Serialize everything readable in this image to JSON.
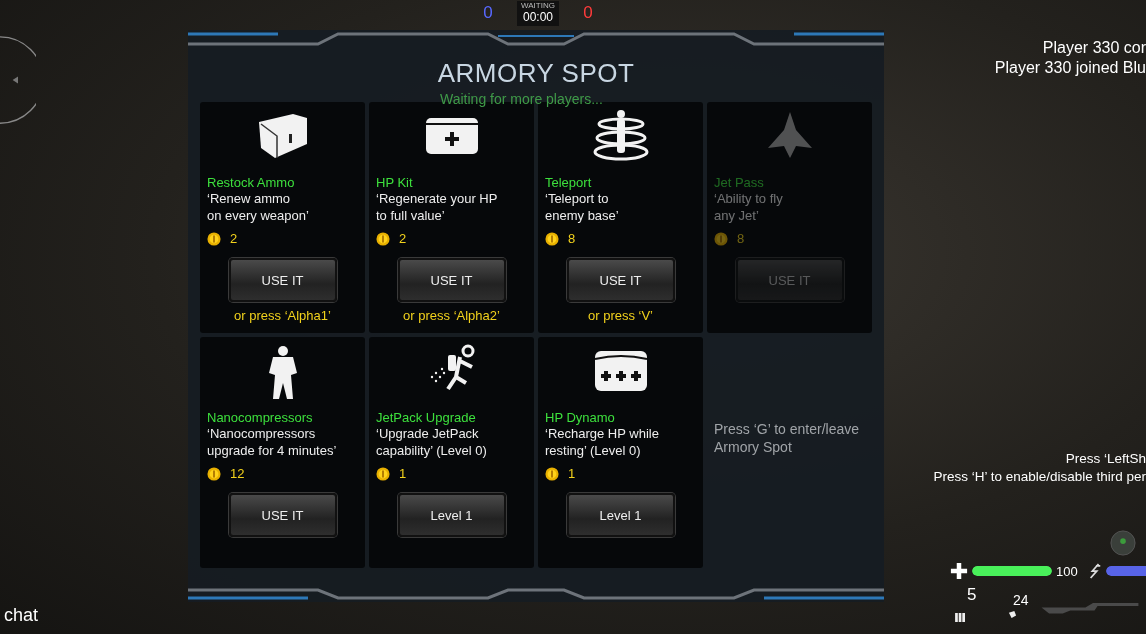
{
  "scoreboard": {
    "blue_score": "0",
    "status": "WAITING",
    "timer": "00:00",
    "red_score": "0"
  },
  "panel": {
    "title": "ARMORY SPOT",
    "items": [
      {
        "name": "Restock Ammo",
        "description": "‘Renew ammo\non every weapon’",
        "price": "2",
        "button": "USE IT",
        "hint": "or press ‘Alpha1’",
        "disabled": false
      },
      {
        "name": "HP Kit",
        "description": "‘Regenerate your HP\nto full value’",
        "price": "2",
        "button": "USE IT",
        "hint": "or press ‘Alpha2’",
        "disabled": false
      },
      {
        "name": "Teleport",
        "description": "‘Teleport to\nenemy base’",
        "price": "8",
        "button": "USE IT",
        "hint": "or press ‘V’",
        "disabled": false
      },
      {
        "name": "Jet Pass",
        "description": "‘Ability to fly\nany Jet’",
        "price": "8",
        "button": "USE IT",
        "disabled": true
      },
      {
        "name": "Nanocompressors",
        "description": "‘Nanocompressors\nupgrade for 4 minutes’",
        "price": "12",
        "button": "USE IT",
        "disabled": false
      },
      {
        "name": "JetPack Upgrade",
        "description": "‘Upgrade JetPack\ncapability’ (Level 0)",
        "price": "1",
        "button": "Level 1",
        "disabled": false
      },
      {
        "name": "HP Dynamo",
        "description": "‘Recharge HP while\nresting’ (Level 0)",
        "price": "1",
        "button": "Level 1",
        "disabled": false
      }
    ]
  },
  "background_messages": [
    "Waiting for more players...",
    "Press ‘G’ to enter/leave Armory Spot"
  ],
  "notifications": [
    "Player 330 cor",
    "Player 330 joined Blu"
  ],
  "hints": [
    "Press ‘LeftSh",
    "Press ‘H’ to enable/disable third per"
  ],
  "hud": {
    "health": {
      "level": 1,
      "reading": "100"
    },
    "jet_fuel": {
      "level": 1
    },
    "grenades": "5",
    "ammo": "24"
  },
  "chat": "chat"
}
